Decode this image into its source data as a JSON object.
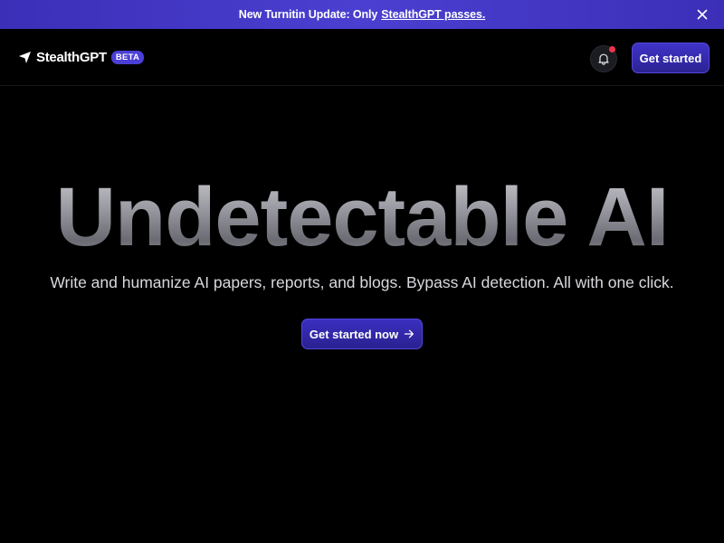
{
  "banner": {
    "text": "New Turnitin Update: Only",
    "link_text": "StealthGPT passes.",
    "close_icon": "close-icon"
  },
  "nav": {
    "brand": "StealthGPT",
    "badge": "BETA",
    "logo_icon": "send-arrow-icon",
    "bell_icon": "bell-icon",
    "cta_label": "Get started"
  },
  "hero": {
    "title": "Undetectable AI",
    "subtitle": "Write and humanize AI papers, reports, and blogs. Bypass AI detection. All with one click.",
    "cta_label": "Get started now",
    "cta_icon": "arrow-right-icon"
  },
  "colors": {
    "background": "#000000",
    "accent": "#4b3fd6",
    "banner": "#3b2fb8",
    "notification_dot": "#f0334d"
  }
}
